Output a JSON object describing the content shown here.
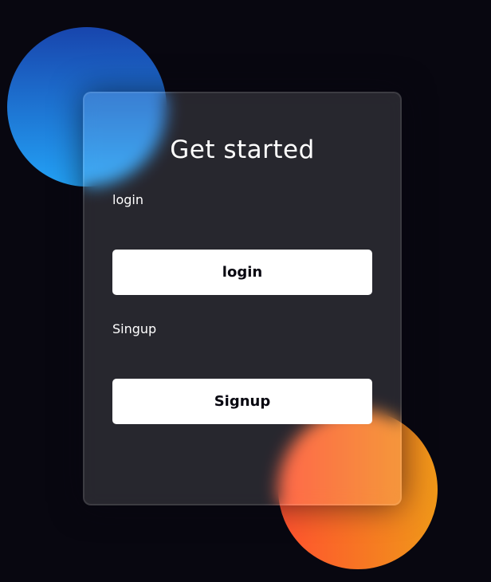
{
  "colors": {
    "background": "#080710",
    "card": "rgba(255,255,255,0.13)",
    "button_bg": "#ffffff",
    "button_text": "#080710",
    "shape_blue": [
      "#1845ad",
      "#23a2f6"
    ],
    "shape_orange": [
      "#ff512f",
      "#f09819"
    ]
  },
  "card": {
    "title": "Get started",
    "login_label": "login",
    "login_button": "login",
    "signup_label": "Singup",
    "signup_button": "Signup"
  }
}
